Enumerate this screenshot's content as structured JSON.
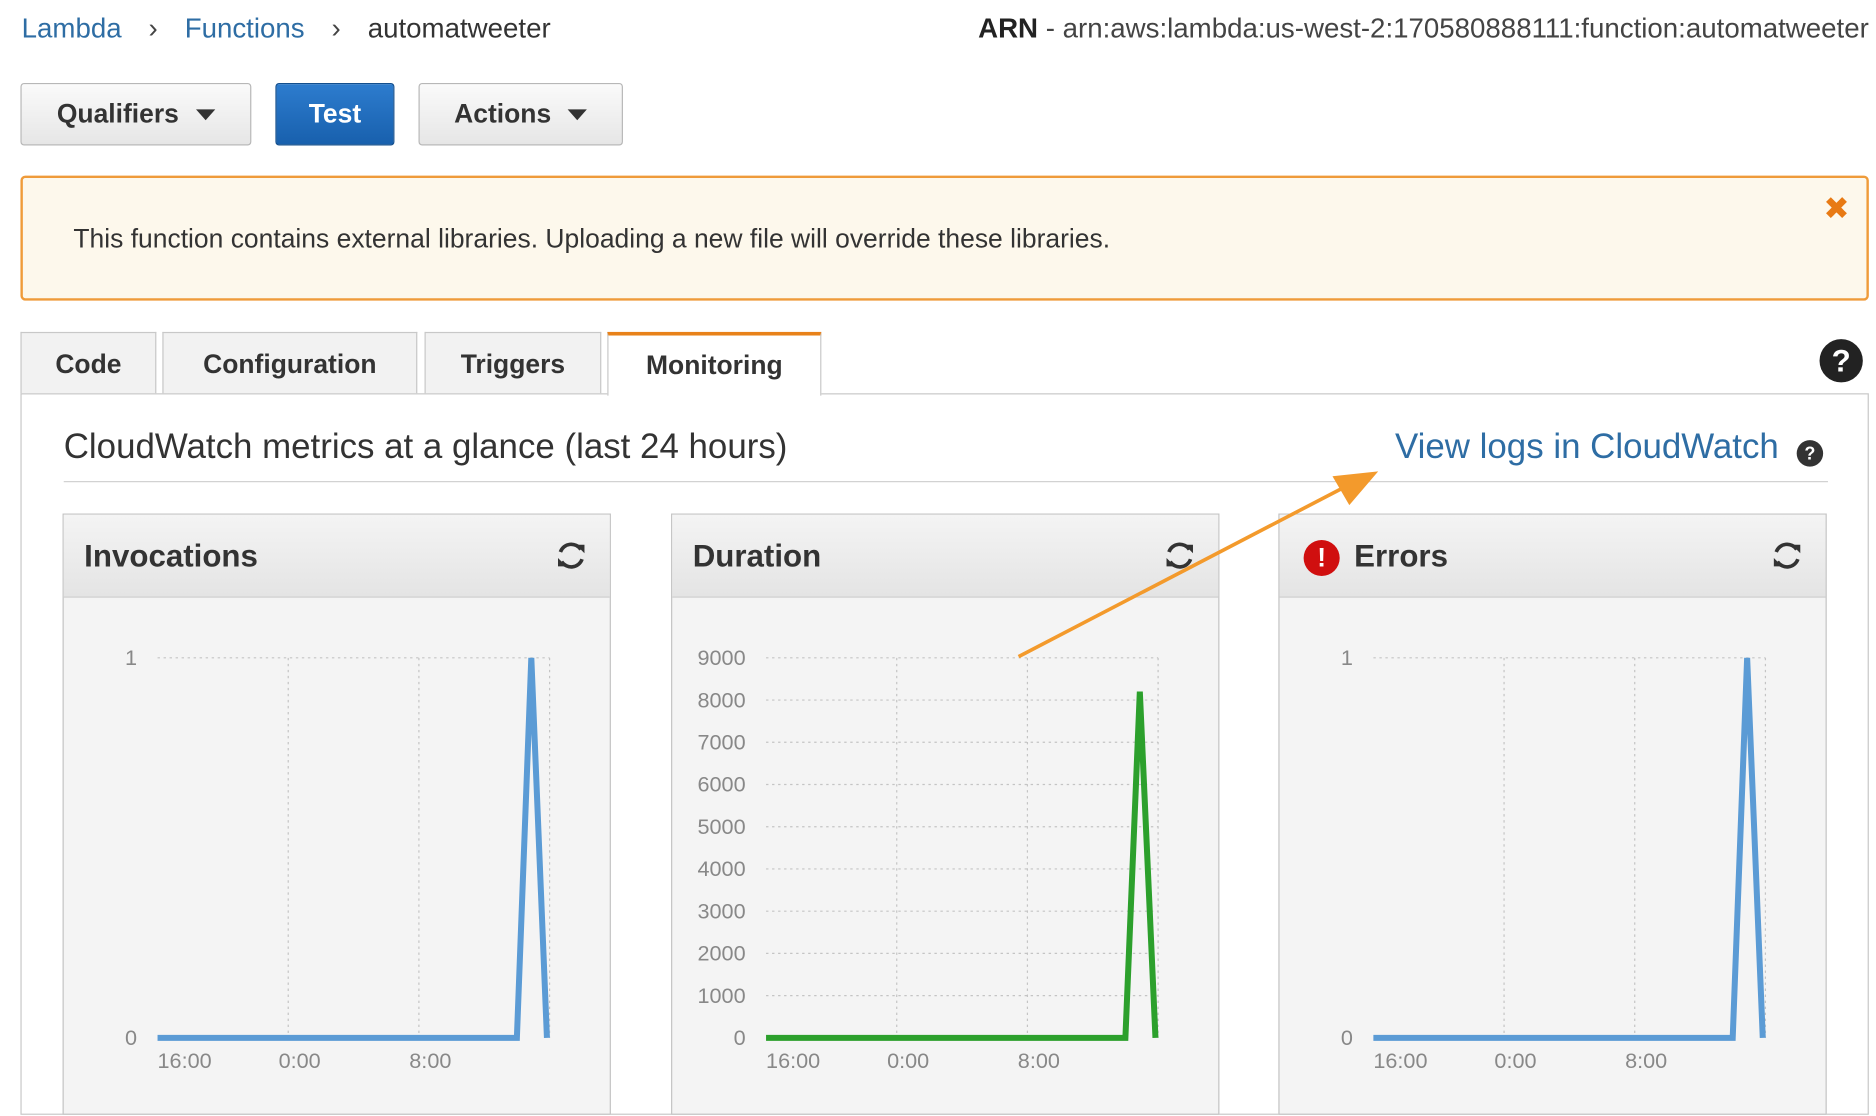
{
  "breadcrumb": {
    "items": [
      "Lambda",
      "Functions",
      "automatweeter"
    ]
  },
  "arn": {
    "label": "ARN",
    "value": " - arn:aws:lambda:us-west-2:170580888111:function:automatweeter"
  },
  "toolbar": {
    "qualifiers_label": "Qualifiers",
    "test_label": "Test",
    "actions_label": "Actions"
  },
  "alert": {
    "message": "This function contains external libraries. Uploading a new file will override these libraries.",
    "close_glyph": "✖"
  },
  "tabs": [
    "Code",
    "Configuration",
    "Triggers",
    "Monitoring"
  ],
  "active_tab": "Monitoring",
  "monitoring": {
    "title": "CloudWatch metrics at a glance (last 24 hours)",
    "view_logs_label": "View logs in CloudWatch"
  },
  "colors": {
    "link": "#2e6da4",
    "primary": "#1f6fc1",
    "alert_border": "#ef9b3a",
    "accent_tab": "#e8821a",
    "blue_series": "#5b9bd5",
    "green_series": "#2ca02c",
    "error": "#d00f0f",
    "arrow": "#f39a2c"
  },
  "chart_data": [
    {
      "type": "line",
      "title": "Invocations",
      "x_ticks": [
        "16:00",
        "0:00",
        "8:00"
      ],
      "y_ticks": [
        "0",
        "1"
      ],
      "ylim": [
        0,
        1
      ],
      "color": "#5b9bd5",
      "points": [
        [
          0,
          0
        ],
        [
          27.5,
          0
        ],
        [
          28.6,
          1
        ],
        [
          29.8,
          0
        ]
      ]
    },
    {
      "type": "line",
      "title": "Duration",
      "x_ticks": [
        "16:00",
        "0:00",
        "8:00"
      ],
      "y_ticks": [
        "0",
        "1000",
        "2000",
        "3000",
        "4000",
        "5000",
        "6000",
        "7000",
        "8000",
        "9000"
      ],
      "ylim": [
        0,
        9000
      ],
      "color": "#2ca02c",
      "points": [
        [
          0,
          0
        ],
        [
          27.5,
          0
        ],
        [
          28.6,
          8200
        ],
        [
          29.8,
          0
        ]
      ]
    },
    {
      "type": "line",
      "title": "Errors",
      "x_ticks": [
        "16:00",
        "0:00",
        "8:00"
      ],
      "y_ticks": [
        "0",
        "1"
      ],
      "ylim": [
        0,
        1
      ],
      "color": "#5b9bd5",
      "points": [
        [
          0,
          0
        ],
        [
          27.5,
          0
        ],
        [
          28.6,
          1
        ],
        [
          29.8,
          0
        ]
      ]
    }
  ]
}
